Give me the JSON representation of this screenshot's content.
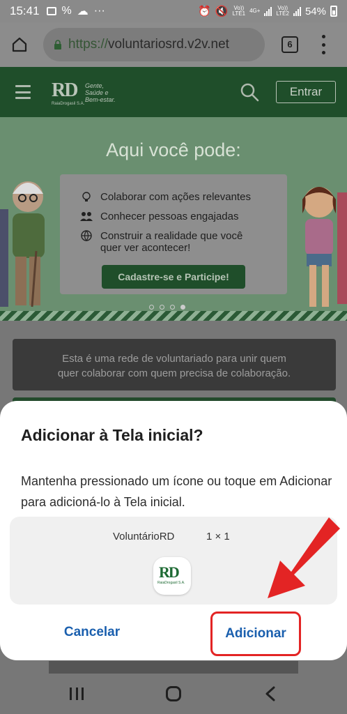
{
  "status_bar": {
    "time": "15:41",
    "net1": "LTE1",
    "net2": "LTE2",
    "net_4g": "4G+",
    "volte": "Vo))",
    "battery": "54%"
  },
  "browser": {
    "url_scheme": "https://",
    "url_host": "voluntariosrd.v2v.net",
    "tab_count": "6"
  },
  "site": {
    "logo_text": "RD",
    "logo_tagline": [
      "Gente,",
      "Saúde e",
      "Bem-estar."
    ],
    "logo_corp": "RaiaDrogasil S.A.",
    "enter_label": "Entrar"
  },
  "hero": {
    "title": "Aqui você pode:",
    "items": [
      "Colaborar com ações relevantes",
      "Conhecer pessoas engajadas",
      "Construir a realidade que você",
      "quer ver acontecer!"
    ],
    "cta_label": "Cadastre-se e Participe!"
  },
  "page": {
    "info_line1": "Esta é uma rede de voluntariado para unir quem",
    "info_line2": "quer colaborar com quem precisa de colaboração."
  },
  "dialog": {
    "title": "Adicionar à Tela inicial?",
    "message": "Mantenha pressionado um ícone ou toque em Adicionar para adicioná-lo à Tela inicial.",
    "app_name": "VoluntárioRD",
    "app_size": "1 × 1",
    "icon_text": "RD",
    "icon_corp": "RaiaDrogasil S.A.",
    "cancel_label": "Cancelar",
    "add_label": "Adicionar"
  },
  "colors": {
    "accent_blue": "#1a5fae",
    "highlight_red": "#e32424",
    "brand_green": "#1f4e2a"
  }
}
